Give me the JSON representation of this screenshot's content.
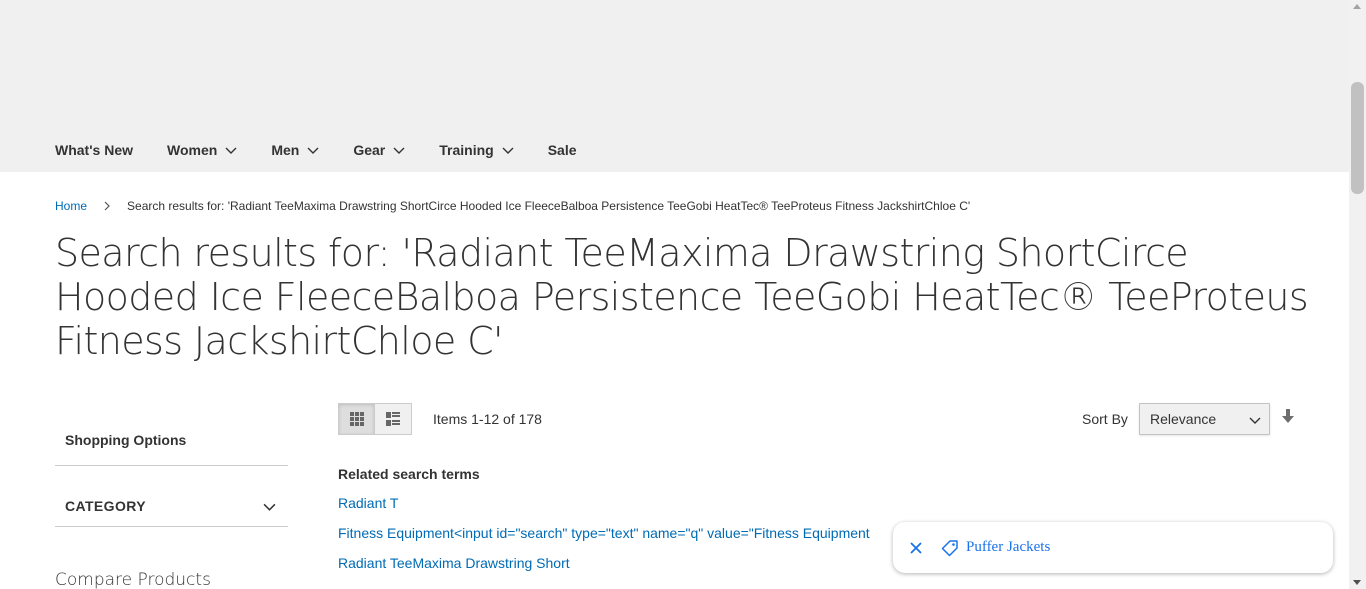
{
  "nav": {
    "items": [
      {
        "label": "What's New",
        "has_dropdown": false
      },
      {
        "label": "Women",
        "has_dropdown": true
      },
      {
        "label": "Men",
        "has_dropdown": true
      },
      {
        "label": "Gear",
        "has_dropdown": true
      },
      {
        "label": "Training",
        "has_dropdown": true
      },
      {
        "label": "Sale",
        "has_dropdown": false
      }
    ]
  },
  "breadcrumb": {
    "home": "Home",
    "current": "Search results for: 'Radiant TeeMaxima Drawstring ShortCirce Hooded Ice FleeceBalboa Persistence TeeGobi HeatTec® TeeProteus Fitness JackshirtChloe C'"
  },
  "page_title": "Search results for: 'Radiant TeeMaxima Drawstring ShortCirce Hooded Ice FleeceBalboa Persistence TeeGobi HeatTec® TeeProteus Fitness JackshirtChloe C'",
  "sidebar": {
    "shopping_options": "Shopping Options",
    "category": "CATEGORY",
    "compare_products": "Compare Products"
  },
  "toolbar": {
    "items_count": "Items 1-12 of 178",
    "sort_label": "Sort By",
    "sort_value": "Relevance",
    "grid_icon": "grid-icon",
    "list_icon": "list-icon",
    "sort_direction_icon": "arrow-down-icon"
  },
  "related": {
    "heading": "Related search terms",
    "terms": [
      "Radiant T",
      "Fitness Equipment<input id=\"search\" type=\"text\" name=\"q\" value=\"Fitness Equipment",
      "Radiant TeeMaxima Drawstring Short"
    ]
  },
  "toast": {
    "label": "Puffer Jackets",
    "close_icon": "close-icon",
    "tag_icon": "tag-icon"
  },
  "colors": {
    "link": "#006bb4",
    "header_bg": "#f0f0f0",
    "toast_text": "#1a73e8"
  }
}
